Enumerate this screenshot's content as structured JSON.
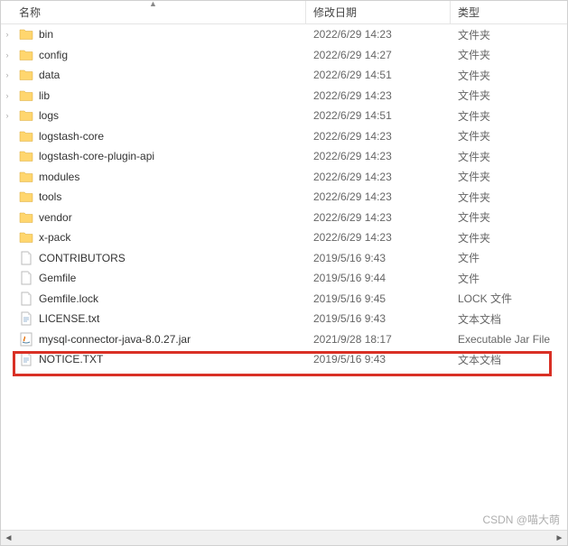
{
  "columns": {
    "name": "名称",
    "date": "修改日期",
    "type": "类型"
  },
  "files": [
    {
      "icon": "folder",
      "expand": true,
      "name": "bin",
      "date": "2022/6/29 14:23",
      "type": "文件夹"
    },
    {
      "icon": "folder",
      "expand": true,
      "name": "config",
      "date": "2022/6/29 14:27",
      "type": "文件夹"
    },
    {
      "icon": "folder",
      "expand": true,
      "name": "data",
      "date": "2022/6/29 14:51",
      "type": "文件夹"
    },
    {
      "icon": "folder",
      "expand": true,
      "name": "lib",
      "date": "2022/6/29 14:23",
      "type": "文件夹"
    },
    {
      "icon": "folder",
      "expand": true,
      "name": "logs",
      "date": "2022/6/29 14:51",
      "type": "文件夹"
    },
    {
      "icon": "folder",
      "expand": false,
      "name": "logstash-core",
      "date": "2022/6/29 14:23",
      "type": "文件夹"
    },
    {
      "icon": "folder",
      "expand": false,
      "name": "logstash-core-plugin-api",
      "date": "2022/6/29 14:23",
      "type": "文件夹"
    },
    {
      "icon": "folder",
      "expand": false,
      "name": "modules",
      "date": "2022/6/29 14:23",
      "type": "文件夹"
    },
    {
      "icon": "folder",
      "expand": false,
      "name": "tools",
      "date": "2022/6/29 14:23",
      "type": "文件夹"
    },
    {
      "icon": "folder",
      "expand": false,
      "name": "vendor",
      "date": "2022/6/29 14:23",
      "type": "文件夹"
    },
    {
      "icon": "folder",
      "expand": false,
      "name": "x-pack",
      "date": "2022/6/29 14:23",
      "type": "文件夹"
    },
    {
      "icon": "file",
      "expand": false,
      "name": "CONTRIBUTORS",
      "date": "2019/5/16 9:43",
      "type": "文件"
    },
    {
      "icon": "file",
      "expand": false,
      "name": "Gemfile",
      "date": "2019/5/16 9:44",
      "type": "文件"
    },
    {
      "icon": "file",
      "expand": false,
      "name": "Gemfile.lock",
      "date": "2019/5/16 9:45",
      "type": "LOCK 文件"
    },
    {
      "icon": "text",
      "expand": false,
      "name": "LICENSE.txt",
      "date": "2019/5/16 9:43",
      "type": "文本文档"
    },
    {
      "icon": "jar",
      "expand": false,
      "name": "mysql-connector-java-8.0.27.jar",
      "date": "2021/9/28 18:17",
      "type": "Executable Jar File",
      "highlighted": true
    },
    {
      "icon": "text",
      "expand": false,
      "name": "NOTICE.TXT",
      "date": "2019/5/16 9:43",
      "type": "文本文档"
    }
  ],
  "watermark": "CSDN @喵大萌"
}
